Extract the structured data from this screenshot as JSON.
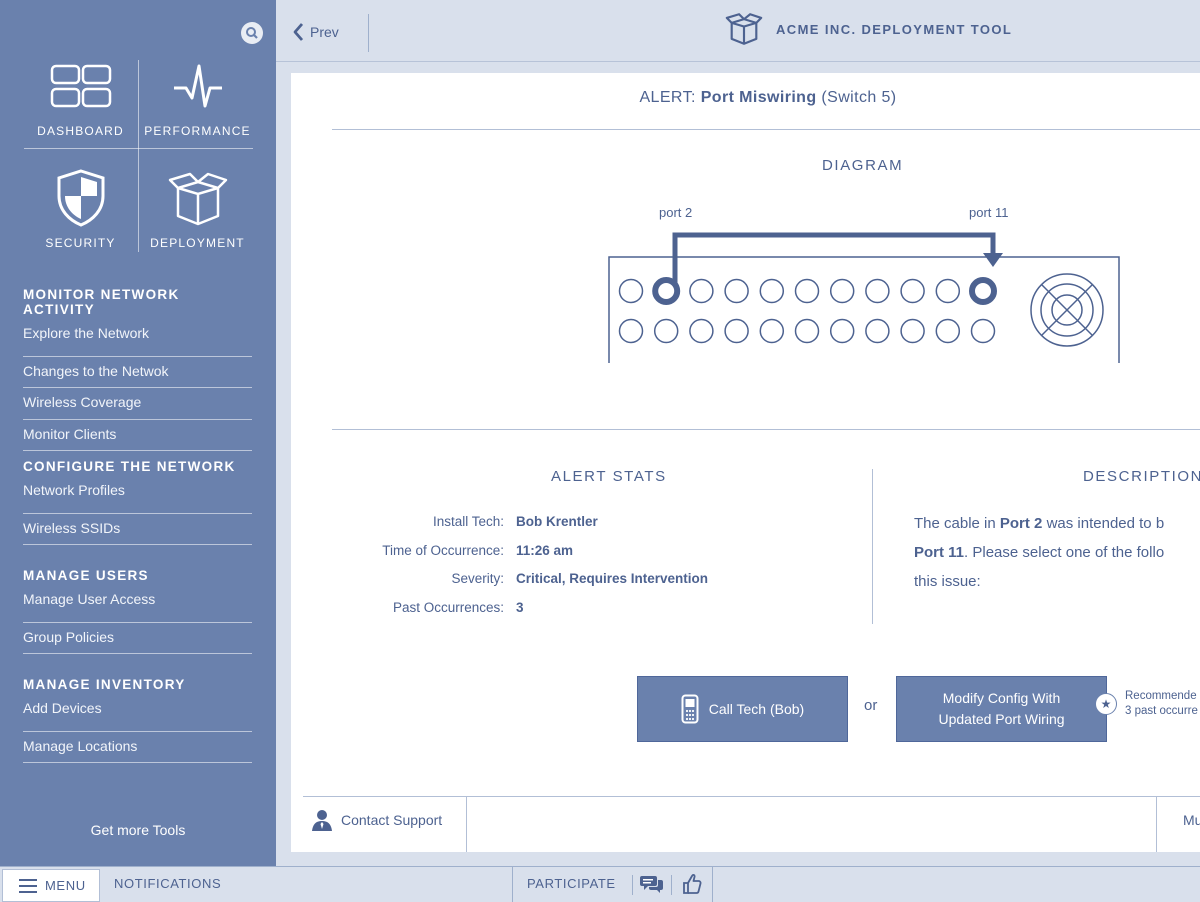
{
  "sidebar": {
    "tiles": [
      {
        "label": "DASHBOARD"
      },
      {
        "label": "PERFORMANCE"
      },
      {
        "label": "SECURITY"
      },
      {
        "label": "DEPLOYMENT"
      }
    ],
    "sections": [
      {
        "title": "MONITOR NETWORK ACTIVITY",
        "items": [
          "Explore the Network",
          "Changes to the Netwok",
          "Wireless Coverage",
          "Monitor Clients"
        ]
      },
      {
        "title": "CONFIGURE THE NETWORK",
        "items": [
          "Network Profiles",
          "Wireless SSIDs"
        ]
      },
      {
        "title": "MANAGE USERS",
        "items": [
          "Manage User Access",
          "Group Policies"
        ]
      },
      {
        "title": "MANAGE INVENTORY",
        "items": [
          "Add Devices",
          "Manage Locations"
        ]
      }
    ],
    "get_more": "Get more Tools"
  },
  "topbar": {
    "prev_label": "Prev",
    "app_title": "ACME INC. DEPLOYMENT TOOL"
  },
  "alert": {
    "prefix": "ALERT:",
    "name": "Port Miswiring",
    "suffix": "(Switch 5)"
  },
  "diagram": {
    "title": "DIAGRAM",
    "port_a_label": "port 2",
    "port_b_label": "port 11"
  },
  "stats": {
    "title": "ALERT STATS",
    "rows": [
      {
        "key": "Install Tech:",
        "value": "Bob Krentler"
      },
      {
        "key": "Time of Occurrence:",
        "value": "11:26 am"
      },
      {
        "key": "Severity:",
        "value": "Critical, Requires Intervention"
      },
      {
        "key": "Past Occurrences:",
        "value": "3"
      }
    ]
  },
  "description": {
    "title": "DESCRIPTION",
    "line1_a": "The cable in ",
    "line1_b": "Port 2",
    "line1_c": " was intended to b",
    "line2_a": "Port 11",
    "line2_b": ". Please select one of the follo",
    "line3": "this issue:"
  },
  "actions": {
    "call_label": "Call Tech (Bob)",
    "or": "or",
    "modify_line1": "Modify Config With",
    "modify_line2": "Updated Port Wiring",
    "rec_line1": "Recommende",
    "rec_line2": "3 past occurre"
  },
  "panel_footer": {
    "contact_label": "Contact Support",
    "right_label": "Mu"
  },
  "bottombar": {
    "menu": "MENU",
    "notifications": "NOTIFICATIONS",
    "participate": "PARTICIPATE"
  }
}
